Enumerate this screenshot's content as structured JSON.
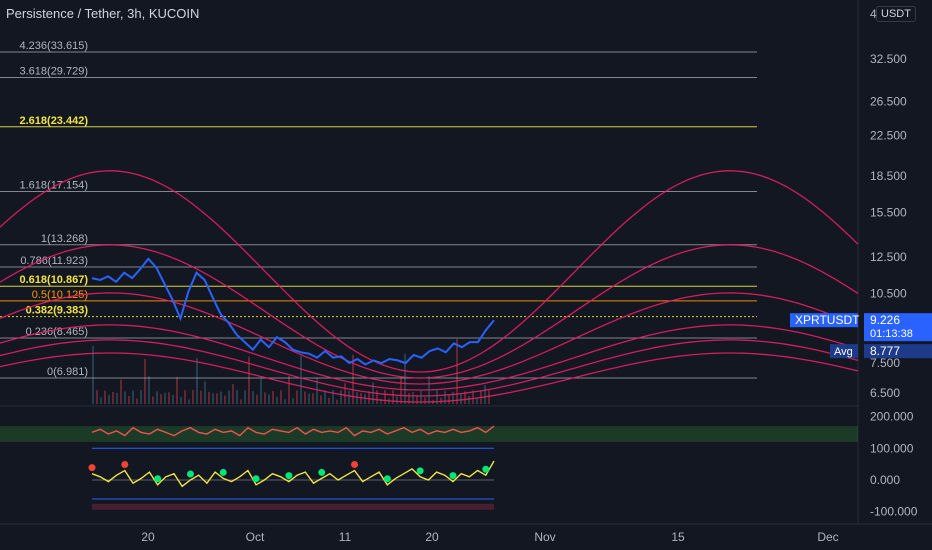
{
  "header": {
    "title": "Persistence / Tether, 3h, KUCOIN",
    "currency_button": "USDT",
    "edge_glyph": "4"
  },
  "colors": {
    "background": "#131722",
    "price_line": "#2962ff",
    "fib_line": "#b2b5be",
    "fib_golden": "#f0e442",
    "fib_half": "#ff9800",
    "arc": "#e91e63",
    "label_bg": "#2962ff",
    "avg_bg": "#1e3a8a"
  },
  "chart_data": [
    {
      "type": "line",
      "title": "Persistence / Tether, 3h, KUCOIN",
      "symbol": "XPRTUSDT",
      "scale": "log",
      "y_ticks": [
        "32.500",
        "26.500",
        "22.500",
        "18.500",
        "15.500",
        "12.500",
        "10.500",
        "7.500",
        "6.500"
      ],
      "x_ticks": [
        "20",
        "Oct",
        "11",
        "20",
        "Nov",
        "15",
        "Dec"
      ],
      "fib_levels": [
        {
          "label": "4.236(33.615)",
          "ratio": 4.236,
          "price": 33.615,
          "style": "normal"
        },
        {
          "label": "3.618(29.729)",
          "ratio": 3.618,
          "price": 29.729,
          "style": "normal"
        },
        {
          "label": "2.618(23.442)",
          "ratio": 2.618,
          "price": 23.442,
          "style": "golden"
        },
        {
          "label": "1.618(17.154)",
          "ratio": 1.618,
          "price": 17.154,
          "style": "normal"
        },
        {
          "label": "1(13.268)",
          "ratio": 1,
          "price": 13.268,
          "style": "normal"
        },
        {
          "label": "0.786(11.923)",
          "ratio": 0.786,
          "price": 11.923,
          "style": "normal"
        },
        {
          "label": "0.618(10.867)",
          "ratio": 0.618,
          "price": 10.867,
          "style": "golden"
        },
        {
          "label": "0.5(10.125)",
          "ratio": 0.5,
          "price": 10.125,
          "style": "half"
        },
        {
          "label": "0.382(9.383)",
          "ratio": 0.382,
          "price": 9.383,
          "style": "golden"
        },
        {
          "label": "0.236(8.465)",
          "ratio": 0.236,
          "price": 8.465,
          "style": "normal"
        },
        {
          "label": "0(6.981)",
          "ratio": 0,
          "price": 6.981,
          "style": "normal"
        }
      ],
      "last_price": {
        "symbol": "XPRTUSDT",
        "value": "9.226",
        "countdown": "01:13:38"
      },
      "avg": {
        "label": "Avg",
        "value": "8.777"
      },
      "series": [
        {
          "values": [
            11.3,
            11.2,
            11.4,
            11.1,
            11.6,
            11.3,
            11.8,
            12.4,
            11.9,
            11.0,
            10.2,
            9.3,
            10.6,
            11.6,
            11.2,
            10.3,
            9.5,
            9.1,
            8.6,
            8.3,
            8.0,
            8.4,
            8.1,
            8.5,
            8.3,
            8.0,
            7.9,
            7.85,
            7.7,
            7.95,
            7.7,
            7.75,
            7.5,
            7.65,
            7.45,
            7.6,
            7.5,
            7.65,
            7.6,
            7.5,
            7.8,
            7.7,
            7.95,
            8.05,
            7.9,
            8.25,
            8.1,
            8.3,
            8.3,
            8.8,
            9.226
          ]
        }
      ]
    },
    {
      "type": "line",
      "title": "",
      "y_ticks": [
        "200.000",
        "100.000",
        "0.000",
        "-100.000"
      ],
      "series": [
        {
          "values": [
            150,
            160,
            145,
            155,
            140,
            165,
            150,
            145,
            160,
            150,
            140,
            155,
            165,
            150,
            145,
            160,
            150,
            155,
            140,
            165,
            150,
            145,
            160,
            155,
            150,
            165,
            145,
            160,
            150,
            155,
            150,
            165,
            140,
            155,
            150,
            160,
            145,
            155,
            165,
            150,
            160,
            145,
            155,
            150,
            160,
            150,
            155,
            165,
            150,
            170
          ]
        },
        {
          "values": [
            20,
            10,
            -5,
            15,
            30,
            -10,
            5,
            25,
            -15,
            10,
            20,
            -20,
            0,
            15,
            -10,
            25,
            5,
            -5,
            10,
            30,
            -15,
            0,
            20,
            10,
            -5,
            15,
            25,
            -10,
            5,
            20,
            0,
            15,
            30,
            -5,
            10,
            25,
            -15,
            5,
            20,
            35,
            10,
            0,
            25,
            15,
            -5,
            20,
            10,
            30,
            15,
            60
          ]
        }
      ]
    }
  ]
}
